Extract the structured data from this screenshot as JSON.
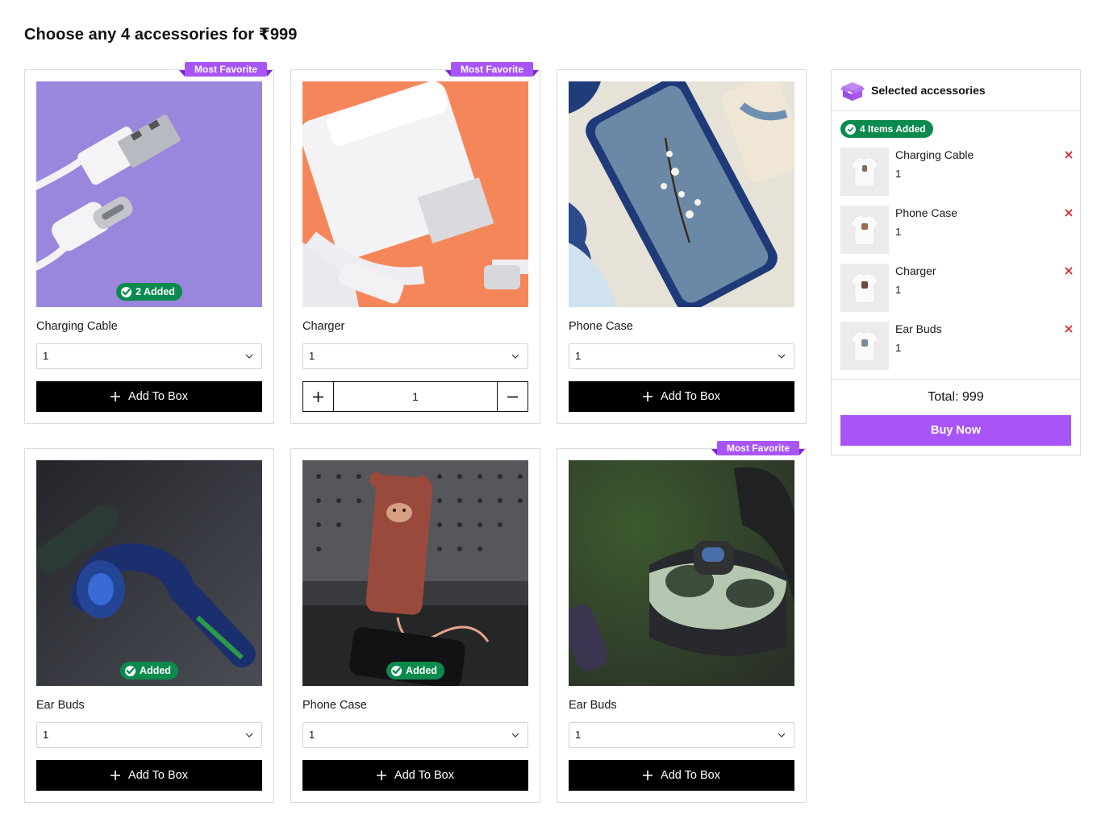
{
  "page": {
    "title": "Choose any 4 accessories for ₹999"
  },
  "colors": {
    "accent": "#a855f7",
    "success": "#0b8a4e",
    "primary_button": "#000000",
    "remove": "#e11d2a"
  },
  "products": [
    {
      "name": "Charging Cable",
      "ribbon": "Most Favorite",
      "badge": "2 Added",
      "qty": "1",
      "action": "Add To Box",
      "image": "charging-cable-photo"
    },
    {
      "name": "Charger",
      "ribbon": "Most Favorite",
      "badge": "",
      "qty": "1",
      "stepper_value": "1",
      "image": "charger-photo"
    },
    {
      "name": "Phone Case",
      "ribbon": "",
      "badge": "",
      "qty": "1",
      "action": "Add To Box",
      "image": "phone-case-photo"
    },
    {
      "name": "Ear Buds",
      "ribbon": "",
      "badge": "Added",
      "qty": "1",
      "action": "Add To Box",
      "image": "earbud-photo"
    },
    {
      "name": "Phone Case",
      "ribbon": "",
      "badge": "Added",
      "qty": "1",
      "action": "Add To Box",
      "image": "bear-phone-case-photo"
    },
    {
      "name": "Ear Buds",
      "ribbon": "Most Favorite",
      "badge": "",
      "qty": "1",
      "action": "Add To Box",
      "image": "earbuds-case-photo"
    }
  ],
  "sidebar": {
    "title": "Selected accessories",
    "items_added": "4 Items Added",
    "items": [
      {
        "name": "Charging Cable",
        "qty": "1"
      },
      {
        "name": "Phone Case",
        "qty": "1"
      },
      {
        "name": "Charger",
        "qty": "1"
      },
      {
        "name": "Ear Buds",
        "qty": "1"
      }
    ],
    "total": "Total: 999",
    "buy_label": "Buy Now"
  }
}
